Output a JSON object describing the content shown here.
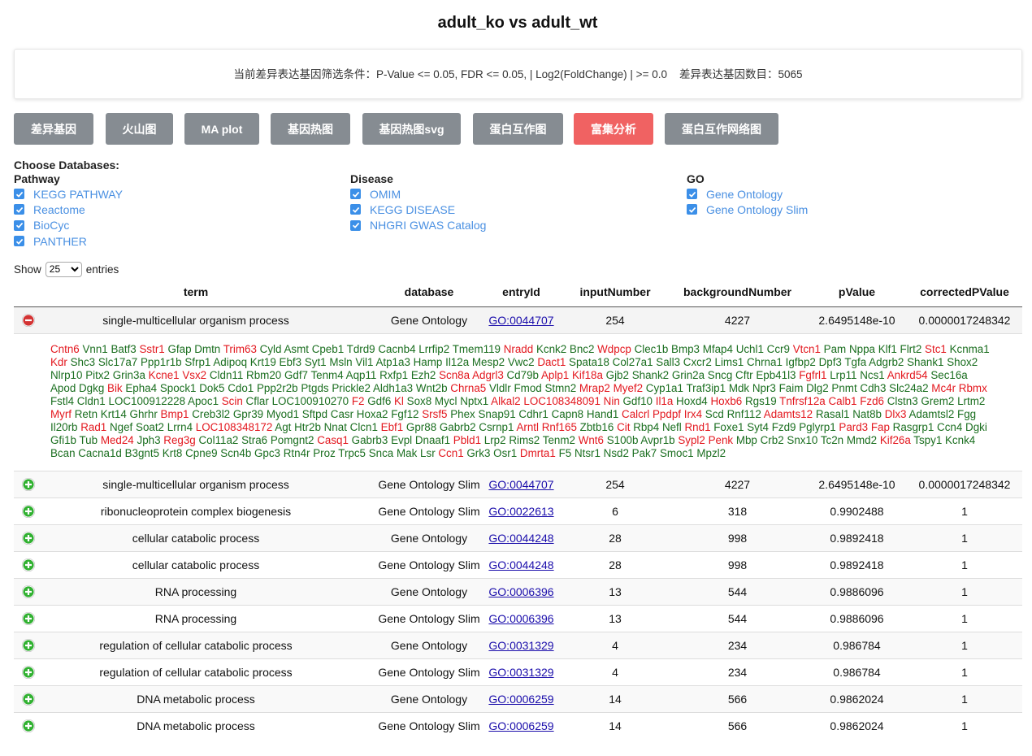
{
  "page": {
    "title": "adult_ko vs adult_wt"
  },
  "filter": {
    "text": "当前差异表达基因筛选条件：P-Value <= 0.05, FDR <= 0.05, | Log2(FoldChange) | >= 0.0    差异表达基因数目：5065"
  },
  "toolbar": {
    "buttons": [
      {
        "label": "差异基因",
        "active": false
      },
      {
        "label": "火山图",
        "active": false
      },
      {
        "label": "MA plot",
        "active": false
      },
      {
        "label": "基因热图",
        "active": false
      },
      {
        "label": "基因热图svg",
        "active": false
      },
      {
        "label": "蛋白互作图",
        "active": false
      },
      {
        "label": "富集分析",
        "active": true
      },
      {
        "label": "蛋白互作网络图",
        "active": false
      }
    ]
  },
  "databases": {
    "title": "Choose Databases:",
    "groups": [
      {
        "name": "Pathway",
        "items": [
          "KEGG PATHWAY",
          "Reactome",
          "BioCyc",
          "PANTHER"
        ]
      },
      {
        "name": "Disease",
        "items": [
          "OMIM",
          "KEGG DISEASE",
          "NHGRI GWAS Catalog"
        ]
      },
      {
        "name": "GO",
        "items": [
          "Gene Ontology",
          "Gene Ontology Slim"
        ]
      }
    ]
  },
  "length_menu": {
    "show": "Show",
    "value": "25",
    "entries": "entries"
  },
  "table": {
    "columns": [
      "term",
      "database",
      "entryId",
      "inputNumber",
      "backgroundNumber",
      "pValue",
      "correctedPValue"
    ],
    "rows": [
      {
        "term": "single-multicellular organism process",
        "database": "Gene Ontology",
        "entryId": "GO:0044707",
        "inputNumber": "254",
        "backgroundNumber": "4227",
        "pValue": "2.6495148e-10",
        "correctedPValue": "0.0000017248342",
        "expanded": true
      },
      {
        "term": "single-multicellular organism process",
        "database": "Gene Ontology Slim",
        "entryId": "GO:0044707",
        "inputNumber": "254",
        "backgroundNumber": "4227",
        "pValue": "2.6495148e-10",
        "correctedPValue": "0.0000017248342",
        "expanded": false
      },
      {
        "term": "ribonucleoprotein complex biogenesis",
        "database": "Gene Ontology Slim",
        "entryId": "GO:0022613",
        "inputNumber": "6",
        "backgroundNumber": "318",
        "pValue": "0.9902488",
        "correctedPValue": "1",
        "expanded": false
      },
      {
        "term": "cellular catabolic process",
        "database": "Gene Ontology",
        "entryId": "GO:0044248",
        "inputNumber": "28",
        "backgroundNumber": "998",
        "pValue": "0.9892418",
        "correctedPValue": "1",
        "expanded": false
      },
      {
        "term": "cellular catabolic process",
        "database": "Gene Ontology Slim",
        "entryId": "GO:0044248",
        "inputNumber": "28",
        "backgroundNumber": "998",
        "pValue": "0.9892418",
        "correctedPValue": "1",
        "expanded": false
      },
      {
        "term": "RNA processing",
        "database": "Gene Ontology",
        "entryId": "GO:0006396",
        "inputNumber": "13",
        "backgroundNumber": "544",
        "pValue": "0.9886096",
        "correctedPValue": "1",
        "expanded": false
      },
      {
        "term": "RNA processing",
        "database": "Gene Ontology Slim",
        "entryId": "GO:0006396",
        "inputNumber": "13",
        "backgroundNumber": "544",
        "pValue": "0.9886096",
        "correctedPValue": "1",
        "expanded": false
      },
      {
        "term": "regulation of cellular catabolic process",
        "database": "Gene Ontology",
        "entryId": "GO:0031329",
        "inputNumber": "4",
        "backgroundNumber": "234",
        "pValue": "0.986784",
        "correctedPValue": "1",
        "expanded": false
      },
      {
        "term": "regulation of cellular catabolic process",
        "database": "Gene Ontology Slim",
        "entryId": "GO:0031329",
        "inputNumber": "4",
        "backgroundNumber": "234",
        "pValue": "0.986784",
        "correctedPValue": "1",
        "expanded": false
      },
      {
        "term": "DNA metabolic process",
        "database": "Gene Ontology",
        "entryId": "GO:0006259",
        "inputNumber": "14",
        "backgroundNumber": "566",
        "pValue": "0.9862024",
        "correctedPValue": "1",
        "expanded": false
      },
      {
        "term": "DNA metabolic process",
        "database": "Gene Ontology Slim",
        "entryId": "GO:0006259",
        "inputNumber": "14",
        "backgroundNumber": "566",
        "pValue": "0.9862024",
        "correctedPValue": "1",
        "expanded": false
      }
    ]
  },
  "genes_expanded": {
    "up_color": "#e3171e",
    "down_color": "#1a6e1f",
    "list": [
      [
        "Cntn6",
        "u"
      ],
      [
        "Vnn1",
        "d"
      ],
      [
        "Batf3",
        "d"
      ],
      [
        "Sstr1",
        "u"
      ],
      [
        "Gfap",
        "d"
      ],
      [
        "Dmtn",
        "d"
      ],
      [
        "Trim63",
        "u"
      ],
      [
        "Cyld",
        "d"
      ],
      [
        "Asmt",
        "d"
      ],
      [
        "Cpeb1",
        "d"
      ],
      [
        "Tdrd9",
        "d"
      ],
      [
        "Cacnb4",
        "d"
      ],
      [
        "Lrrfip2",
        "d"
      ],
      [
        "Tmem119",
        "d"
      ],
      [
        "Nradd",
        "u"
      ],
      [
        "Kcnk2",
        "d"
      ],
      [
        "Bnc2",
        "d"
      ],
      [
        "Wdpcp",
        "u"
      ],
      [
        "Clec1b",
        "d"
      ],
      [
        "Bmp3",
        "d"
      ],
      [
        "Mfap4",
        "d"
      ],
      [
        "Uchl1",
        "d"
      ],
      [
        "Ccr9",
        "d"
      ],
      [
        "Vtcn1",
        "u"
      ],
      [
        "Pam",
        "d"
      ],
      [
        "Nppa",
        "d"
      ],
      [
        "Klf1",
        "d"
      ],
      [
        "Flrt2",
        "d"
      ],
      [
        "Stc1",
        "u"
      ],
      [
        "Kcnma1",
        "d"
      ],
      [
        "Kdr",
        "u"
      ],
      [
        "Shc3",
        "d"
      ],
      [
        "Slc17a7",
        "d"
      ],
      [
        "Ppp1r1b",
        "d"
      ],
      [
        "Sfrp1",
        "d"
      ],
      [
        "Adipoq",
        "d"
      ],
      [
        "Krt19",
        "d"
      ],
      [
        "Ebf3",
        "d"
      ],
      [
        "Syt1",
        "d"
      ],
      [
        "Msln",
        "d"
      ],
      [
        "Vil1",
        "d"
      ],
      [
        "Atp1a3",
        "d"
      ],
      [
        "Hamp",
        "d"
      ],
      [
        "Il12a",
        "d"
      ],
      [
        "Mesp2",
        "d"
      ],
      [
        "Vwc2",
        "d"
      ],
      [
        "Dact1",
        "u"
      ],
      [
        "Spata18",
        "d"
      ],
      [
        "Col27a1",
        "d"
      ],
      [
        "Sall3",
        "d"
      ],
      [
        "Cxcr2",
        "d"
      ],
      [
        "Lims1",
        "d"
      ],
      [
        "Chrna1",
        "d"
      ],
      [
        "Igfbp2",
        "d"
      ],
      [
        "Dpf3",
        "d"
      ],
      [
        "Tgfa",
        "d"
      ],
      [
        "Adgrb2",
        "d"
      ],
      [
        "Shank1",
        "d"
      ],
      [
        "Shox2",
        "d"
      ],
      [
        "Nlrp10",
        "d"
      ],
      [
        "Pitx2",
        "d"
      ],
      [
        "Grin3a",
        "d"
      ],
      [
        "Kcne1",
        "u"
      ],
      [
        "Vsx2",
        "u"
      ],
      [
        "Cldn11",
        "d"
      ],
      [
        "Rbm20",
        "d"
      ],
      [
        "Gdf7",
        "d"
      ],
      [
        "Tenm4",
        "d"
      ],
      [
        "Aqp11",
        "d"
      ],
      [
        "Rxfp1",
        "d"
      ],
      [
        "Ezh2",
        "d"
      ],
      [
        "Scn8a",
        "u"
      ],
      [
        "Adgrl3",
        "u"
      ],
      [
        "Cd79b",
        "d"
      ],
      [
        "Aplp1",
        "u"
      ],
      [
        "Kif18a",
        "u"
      ],
      [
        "Gjb2",
        "d"
      ],
      [
        "Shank2",
        "d"
      ],
      [
        "Grin2a",
        "d"
      ],
      [
        "Sncg",
        "d"
      ],
      [
        "Cftr",
        "d"
      ],
      [
        "Epb41l3",
        "d"
      ],
      [
        "Fgfrl1",
        "u"
      ],
      [
        "Lrp11",
        "d"
      ],
      [
        "Ncs1",
        "d"
      ],
      [
        "Ankrd54",
        "u"
      ],
      [
        "Sec16a",
        "d"
      ],
      [
        "Apod",
        "d"
      ],
      [
        "Dgkg",
        "d"
      ],
      [
        "Bik",
        "u"
      ],
      [
        "Epha4",
        "d"
      ],
      [
        "Spock1",
        "d"
      ],
      [
        "Dok5",
        "d"
      ],
      [
        "Cdo1",
        "d"
      ],
      [
        "Ppp2r2b",
        "d"
      ],
      [
        "Ptgds",
        "d"
      ],
      [
        "Prickle2",
        "d"
      ],
      [
        "Aldh1a3",
        "d"
      ],
      [
        "Wnt2b",
        "d"
      ],
      [
        "Chrna5",
        "u"
      ],
      [
        "Vldlr",
        "d"
      ],
      [
        "Fmod",
        "d"
      ],
      [
        "Stmn2",
        "d"
      ],
      [
        "Mrap2",
        "u"
      ],
      [
        "Myef2",
        "u"
      ],
      [
        "Cyp1a1",
        "d"
      ],
      [
        "Traf3ip1",
        "d"
      ],
      [
        "Mdk",
        "d"
      ],
      [
        "Npr3",
        "d"
      ],
      [
        "Faim",
        "d"
      ],
      [
        "Dlg2",
        "d"
      ],
      [
        "Pnmt",
        "d"
      ],
      [
        "Cdh3",
        "d"
      ],
      [
        "Slc24a2",
        "d"
      ],
      [
        "Mc4r",
        "u"
      ],
      [
        "Rbmx",
        "u"
      ],
      [
        "Fstl4",
        "d"
      ],
      [
        "Cldn1",
        "d"
      ],
      [
        "LOC100912228",
        "d"
      ],
      [
        "Apoc1",
        "d"
      ],
      [
        "Scin",
        "u"
      ],
      [
        "Cflar",
        "d"
      ],
      [
        "LOC100910270",
        "d"
      ],
      [
        "F2",
        "u"
      ],
      [
        "Gdf6",
        "d"
      ],
      [
        "Kl",
        "u"
      ],
      [
        "Sox8",
        "d"
      ],
      [
        "Mycl",
        "d"
      ],
      [
        "Nptx1",
        "d"
      ],
      [
        "Alkal2",
        "u"
      ],
      [
        "LOC108348091",
        "u"
      ],
      [
        "Nin",
        "u"
      ],
      [
        "Gdf10",
        "d"
      ],
      [
        "Il1a",
        "u"
      ],
      [
        "Hoxd4",
        "d"
      ],
      [
        "Hoxb6",
        "u"
      ],
      [
        "Rgs19",
        "d"
      ],
      [
        "Tnfrsf12a",
        "u"
      ],
      [
        "Calb1",
        "u"
      ],
      [
        "Fzd6",
        "u"
      ],
      [
        "Clstn3",
        "d"
      ],
      [
        "Grem2",
        "d"
      ],
      [
        "Lrtm2",
        "d"
      ],
      [
        "Myrf",
        "u"
      ],
      [
        "Retn",
        "d"
      ],
      [
        "Krt14",
        "d"
      ],
      [
        "Ghrhr",
        "d"
      ],
      [
        "Bmp1",
        "u"
      ],
      [
        "Creb3l2",
        "d"
      ],
      [
        "Gpr39",
        "d"
      ],
      [
        "Myod1",
        "d"
      ],
      [
        "Sftpd",
        "d"
      ],
      [
        "Casr",
        "d"
      ],
      [
        "Hoxa2",
        "d"
      ],
      [
        "Fgf12",
        "d"
      ],
      [
        "Srsf5",
        "u"
      ],
      [
        "Phex",
        "d"
      ],
      [
        "Snap91",
        "d"
      ],
      [
        "Cdhr1",
        "d"
      ],
      [
        "Capn8",
        "d"
      ],
      [
        "Hand1",
        "d"
      ],
      [
        "Calcrl",
        "u"
      ],
      [
        "Ppdpf",
        "u"
      ],
      [
        "Irx4",
        "u"
      ],
      [
        "Scd",
        "d"
      ],
      [
        "Rnf112",
        "d"
      ],
      [
        "Adamts12",
        "u"
      ],
      [
        "Rasal1",
        "d"
      ],
      [
        "Nat8b",
        "d"
      ],
      [
        "Dlx3",
        "u"
      ],
      [
        "Adamtsl2",
        "d"
      ],
      [
        "Fgg",
        "d"
      ],
      [
        "Il20rb",
        "d"
      ],
      [
        "Rad1",
        "u"
      ],
      [
        "Ngef",
        "d"
      ],
      [
        "Soat2",
        "d"
      ],
      [
        "Lrrn4",
        "d"
      ],
      [
        "LOC108348172",
        "u"
      ],
      [
        "Agt",
        "d"
      ],
      [
        "Htr2b",
        "d"
      ],
      [
        "Nnat",
        "d"
      ],
      [
        "Clcn1",
        "d"
      ],
      [
        "Ebf1",
        "u"
      ],
      [
        "Gpr88",
        "d"
      ],
      [
        "Gabrb2",
        "d"
      ],
      [
        "Csrnp1",
        "d"
      ],
      [
        "Arntl",
        "u"
      ],
      [
        "Rnf165",
        "u"
      ],
      [
        "Zbtb16",
        "d"
      ],
      [
        "Cit",
        "u"
      ],
      [
        "Rbp4",
        "d"
      ],
      [
        "Nefl",
        "d"
      ],
      [
        "Rnd1",
        "u"
      ],
      [
        "Foxe1",
        "d"
      ],
      [
        "Syt4",
        "d"
      ],
      [
        "Fzd9",
        "d"
      ],
      [
        "Pglyrp1",
        "d"
      ],
      [
        "Pard3",
        "u"
      ],
      [
        "Fap",
        "u"
      ],
      [
        "Rasgrp1",
        "d"
      ],
      [
        "Ccn4",
        "d"
      ],
      [
        "Dgki",
        "d"
      ],
      [
        "Gfi1b",
        "d"
      ],
      [
        "Tub",
        "d"
      ],
      [
        "Med24",
        "u"
      ],
      [
        "Jph3",
        "d"
      ],
      [
        "Reg3g",
        "u"
      ],
      [
        "Col11a2",
        "d"
      ],
      [
        "Stra6",
        "d"
      ],
      [
        "Pomgnt2",
        "d"
      ],
      [
        "Casq1",
        "u"
      ],
      [
        "Gabrb3",
        "d"
      ],
      [
        "Evpl",
        "d"
      ],
      [
        "Dnaaf1",
        "d"
      ],
      [
        "Pbld1",
        "u"
      ],
      [
        "Lrp2",
        "d"
      ],
      [
        "Rims2",
        "d"
      ],
      [
        "Tenm2",
        "d"
      ],
      [
        "Wnt6",
        "u"
      ],
      [
        "S100b",
        "d"
      ],
      [
        "Avpr1b",
        "d"
      ],
      [
        "Sypl2",
        "u"
      ],
      [
        "Penk",
        "u"
      ],
      [
        "Mbp",
        "d"
      ],
      [
        "Crb2",
        "d"
      ],
      [
        "Snx10",
        "d"
      ],
      [
        "Tc2n",
        "d"
      ],
      [
        "Mmd2",
        "d"
      ],
      [
        "Kif26a",
        "u"
      ],
      [
        "Tspy1",
        "d"
      ],
      [
        "Kcnk4",
        "d"
      ],
      [
        "Bcan",
        "d"
      ],
      [
        "Cacna1d",
        "d"
      ],
      [
        "B3gnt5",
        "d"
      ],
      [
        "Krt8",
        "d"
      ],
      [
        "Cpne9",
        "d"
      ],
      [
        "Scn4b",
        "d"
      ],
      [
        "Gpc3",
        "d"
      ],
      [
        "Rtn4r",
        "d"
      ],
      [
        "Proz",
        "d"
      ],
      [
        "Trpc5",
        "d"
      ],
      [
        "Snca",
        "d"
      ],
      [
        "Mak",
        "d"
      ],
      [
        "Lsr",
        "d"
      ],
      [
        "Ccn1",
        "u"
      ],
      [
        "Grk3",
        "d"
      ],
      [
        "Osr1",
        "d"
      ],
      [
        "Dmrta1",
        "u"
      ],
      [
        "F5",
        "d"
      ],
      [
        "Ntsr1",
        "d"
      ],
      [
        "Nsd2",
        "d"
      ],
      [
        "Pak7",
        "d"
      ],
      [
        "Smoc1",
        "d"
      ],
      [
        "Mpzl2",
        "d"
      ]
    ]
  }
}
